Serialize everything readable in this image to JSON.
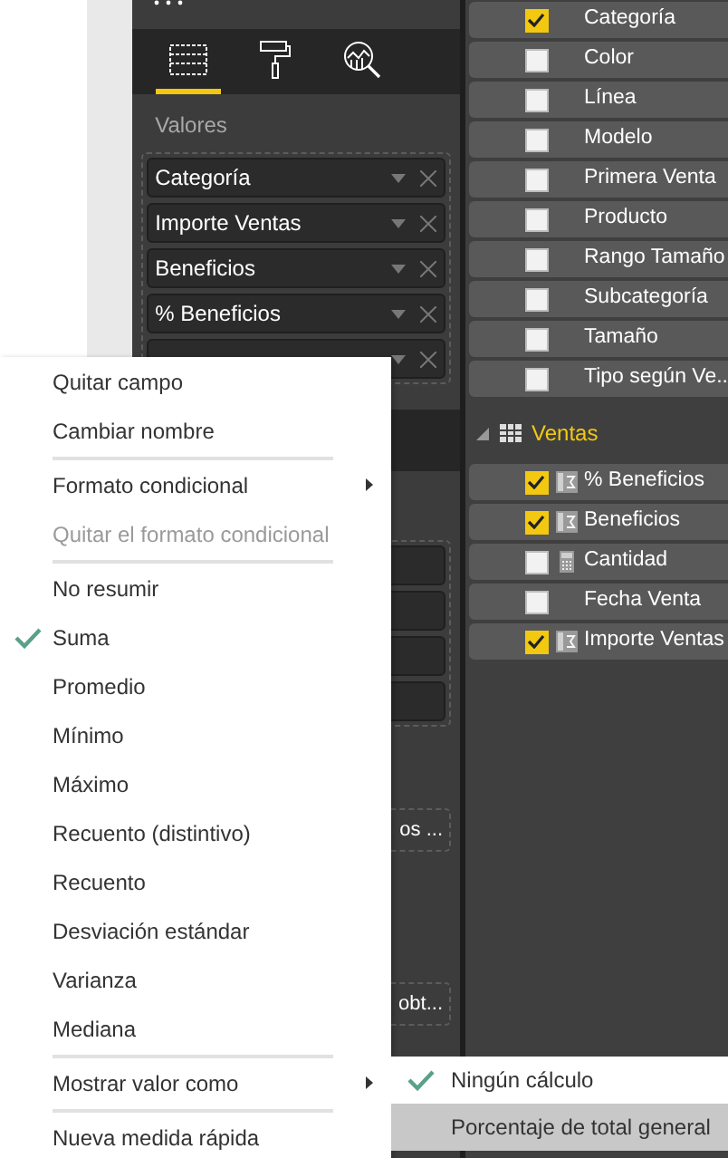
{
  "visual_tabs": [
    {
      "kind": "fields",
      "selected": true
    },
    {
      "kind": "format",
      "selected": false
    },
    {
      "kind": "analytics",
      "selected": false
    }
  ],
  "values_well": {
    "label": "Valores",
    "fields": [
      "Categoría",
      "Importe Ventas",
      "Beneficios",
      "% Beneficios"
    ]
  },
  "drop_fragments": [
    "os ...",
    "obt..."
  ],
  "field_list": {
    "items": [
      {
        "label": "Categoría",
        "checked": true,
        "kind": "plain"
      },
      {
        "label": "Color",
        "checked": false,
        "kind": "plain"
      },
      {
        "label": "Línea",
        "checked": false,
        "kind": "plain"
      },
      {
        "label": "Modelo",
        "checked": false,
        "kind": "plain"
      },
      {
        "label": "Primera Venta",
        "checked": false,
        "kind": "plain"
      },
      {
        "label": "Producto",
        "checked": false,
        "kind": "plain"
      },
      {
        "label": "Rango Tamaño",
        "checked": false,
        "kind": "plain"
      },
      {
        "label": "Subcategoría",
        "checked": false,
        "kind": "plain"
      },
      {
        "label": "Tamaño",
        "checked": false,
        "kind": "plain"
      },
      {
        "label": "Tipo según Ve..",
        "checked": false,
        "kind": "plain"
      }
    ],
    "group": {
      "label": "Ventas",
      "expanded": true,
      "items": [
        {
          "label": "% Beneficios",
          "checked": true,
          "kind": "measure"
        },
        {
          "label": "Beneficios",
          "checked": true,
          "kind": "measure"
        },
        {
          "label": "Cantidad",
          "checked": false,
          "kind": "numeric"
        },
        {
          "label": "Fecha Venta",
          "checked": false,
          "kind": "plain"
        },
        {
          "label": "Importe Ventas",
          "checked": true,
          "kind": "measure"
        }
      ]
    }
  },
  "context_menu": [
    {
      "kind": "item",
      "label": "Quitar campo",
      "checked": false,
      "disabled": false,
      "submenu": false
    },
    {
      "kind": "item",
      "label": "Cambiar nombre",
      "checked": false,
      "disabled": false,
      "submenu": false
    },
    {
      "kind": "separator"
    },
    {
      "kind": "item",
      "label": "Formato condicional",
      "checked": false,
      "disabled": false,
      "submenu": true
    },
    {
      "kind": "item",
      "label": "Quitar el formato condicional",
      "checked": false,
      "disabled": true,
      "submenu": false
    },
    {
      "kind": "separator"
    },
    {
      "kind": "item",
      "label": "No resumir",
      "checked": false,
      "disabled": false,
      "submenu": false
    },
    {
      "kind": "item",
      "label": "Suma",
      "checked": true,
      "disabled": false,
      "submenu": false
    },
    {
      "kind": "item",
      "label": "Promedio",
      "checked": false,
      "disabled": false,
      "submenu": false
    },
    {
      "kind": "item",
      "label": "Mínimo",
      "checked": false,
      "disabled": false,
      "submenu": false
    },
    {
      "kind": "item",
      "label": "Máximo",
      "checked": false,
      "disabled": false,
      "submenu": false
    },
    {
      "kind": "item",
      "label": "Recuento (distintivo)",
      "checked": false,
      "disabled": false,
      "submenu": false
    },
    {
      "kind": "item",
      "label": "Recuento",
      "checked": false,
      "disabled": false,
      "submenu": false
    },
    {
      "kind": "item",
      "label": "Desviación estándar",
      "checked": false,
      "disabled": false,
      "submenu": false
    },
    {
      "kind": "item",
      "label": "Varianza",
      "checked": false,
      "disabled": false,
      "submenu": false
    },
    {
      "kind": "item",
      "label": "Mediana",
      "checked": false,
      "disabled": false,
      "submenu": false
    },
    {
      "kind": "separator"
    },
    {
      "kind": "item",
      "label": "Mostrar valor como",
      "checked": false,
      "disabled": false,
      "submenu": true
    },
    {
      "kind": "separator"
    },
    {
      "kind": "item",
      "label": "Nueva medida rápida",
      "checked": false,
      "disabled": false,
      "submenu": false
    }
  ],
  "submenu": [
    {
      "label": "Ningún cálculo",
      "checked": true,
      "selected": false
    },
    {
      "label": "Porcentaje de total general",
      "checked": false,
      "selected": true
    }
  ]
}
